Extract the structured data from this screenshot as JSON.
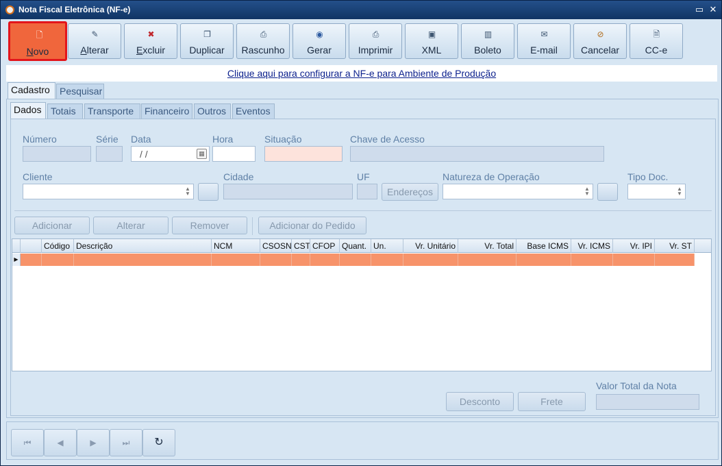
{
  "window": {
    "title": "Nota Fiscal Eletrônica (NF-e)"
  },
  "toolbar": {
    "buttons": [
      {
        "label_ul": "N",
        "label_rest": "ovo",
        "icon": "new-document-icon"
      },
      {
        "label_ul": "A",
        "label_rest": "lterar",
        "icon": "edit-pencil-icon"
      },
      {
        "label_ul": "E",
        "label_rest": "xcluir",
        "icon": "delete-document-icon"
      },
      {
        "label": "Duplicar",
        "icon": "duplicate-icon"
      },
      {
        "label": "Rascunho",
        "icon": "draft-icon"
      },
      {
        "label": "Gerar",
        "icon": "generate-icon"
      },
      {
        "label": "Imprimir",
        "icon": "printer-icon"
      },
      {
        "label": "XML",
        "icon": "save-disk-icon"
      },
      {
        "label": "Boleto",
        "icon": "barcode-icon"
      },
      {
        "label": "E-mail",
        "icon": "envelope-icon"
      },
      {
        "label": "Cancelar",
        "icon": "cancel-icon"
      },
      {
        "label": "CC-e",
        "icon": "cce-document-icon"
      }
    ]
  },
  "config_link": "Clique aqui para configurar a NF-e para Ambiente de Produção",
  "outer_tabs": [
    "Cadastro",
    "Pesquisar"
  ],
  "inner_tabs": [
    "Dados",
    "Totais",
    "Transporte",
    "Financeiro",
    "Outros",
    "Eventos"
  ],
  "fields": {
    "numero": "Número",
    "serie": "Série",
    "data": "Data",
    "data_value": " /  /",
    "hora": "Hora",
    "situacao": "Situação",
    "chave": "Chave de Acesso",
    "cliente": "Cliente",
    "cidade": "Cidade",
    "uf": "UF",
    "enderecos_button": "Endereços",
    "natureza": "Natureza de Operação",
    "tipo_doc": "Tipo Doc."
  },
  "item_buttons": {
    "adicionar": "Adicionar",
    "alterar": "Alterar",
    "remover": "Remover",
    "adicionar_pedido": "Adicionar do Pedido"
  },
  "grid": {
    "columns": [
      "Código",
      "Descrição",
      "NCM",
      "CSOSN",
      "CST",
      "CFOP",
      "Quant.",
      "Un.",
      "Vr. Unitário",
      "Vr. Total",
      "Base ICMS",
      "Vr. ICMS",
      "Vr. IPI",
      "Vr. ST"
    ]
  },
  "footer": {
    "desconto": "Desconto",
    "frete": "Frete",
    "valor_total_label": "Valor Total da Nota"
  },
  "nav": {
    "first_icon": "first-record-icon",
    "prev_icon": "previous-record-icon",
    "next_icon": "next-record-icon",
    "last_icon": "last-record-icon",
    "refresh_icon": "refresh-icon"
  },
  "colors": {
    "accent": "#f0663c",
    "selection_row": "#f7936a",
    "title_bar": "#103464"
  }
}
